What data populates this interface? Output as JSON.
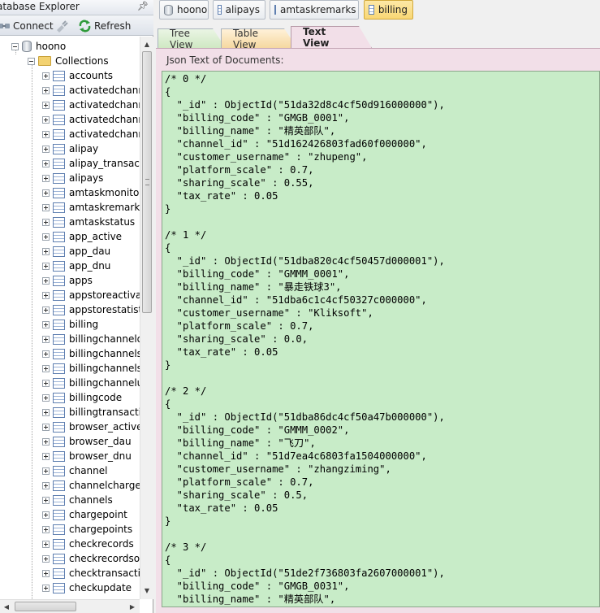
{
  "explorer": {
    "title": "atabase Explorer",
    "toolbar": {
      "connect": "Connect",
      "refresh": "Refresh"
    },
    "server": "hoono",
    "collections_label": "Collections",
    "collections": [
      "accounts",
      "activatedchann",
      "activatedchann",
      "activatedchann",
      "activatedchann",
      "alipay",
      "alipay_transacti",
      "alipays",
      "amtaskmonitor",
      "amtaskremarks",
      "amtaskstatus",
      "app_active",
      "app_dau",
      "app_dnu",
      "apps",
      "appstoreactivat",
      "appstorestatisti",
      "billing",
      "billingchanneld",
      "billingchannels",
      "billingchannels",
      "billingchannelu",
      "billingcode",
      "billingtransactio",
      "browser_active",
      "browser_dau",
      "browser_dnu",
      "channel",
      "channelchargep",
      "channels",
      "chargepoint",
      "chargepoints",
      "checkrecords",
      "checkrecordsor",
      "checktransactio",
      "checkupdate"
    ]
  },
  "doc_tabs": [
    {
      "label": "hoono",
      "icon": "database-icon"
    },
    {
      "label": "alipays",
      "icon": "table-icon"
    },
    {
      "label": "amtaskremarks",
      "icon": "table-icon"
    },
    {
      "label": "billing",
      "icon": "table-icon",
      "active": true
    }
  ],
  "view_tabs": {
    "tree": "Tree View",
    "table": "Table View",
    "text": "Text View"
  },
  "content": {
    "label": "Json Text of Documents:",
    "json_text": "/* 0 */\n{\n  \"_id\" : ObjectId(\"51da32d8c4cf50d916000000\"),\n  \"billing_code\" : \"GMGB_0001\",\n  \"billing_name\" : \"精英部队\",\n  \"channel_id\" : \"51d162426803fad60f000000\",\n  \"customer_username\" : \"zhupeng\",\n  \"platform_scale\" : 0.7,\n  \"sharing_scale\" : 0.55,\n  \"tax_rate\" : 0.05\n}\n\n/* 1 */\n{\n  \"_id\" : ObjectId(\"51dba820c4cf50457d000001\"),\n  \"billing_code\" : \"GMMM_0001\",\n  \"billing_name\" : \"暴走铁球3\",\n  \"channel_id\" : \"51dba6c1c4cf50327c000000\",\n  \"customer_username\" : \"Kliksoft\",\n  \"platform_scale\" : 0.7,\n  \"sharing_scale\" : 0.0,\n  \"tax_rate\" : 0.05\n}\n\n/* 2 */\n{\n  \"_id\" : ObjectId(\"51dba86dc4cf50a47b000000\"),\n  \"billing_code\" : \"GMMM_0002\",\n  \"billing_name\" : \"飞刀\",\n  \"channel_id\" : \"51d7ea4c6803fa1504000000\",\n  \"customer_username\" : \"zhangziming\",\n  \"platform_scale\" : 0.7,\n  \"sharing_scale\" : 0.5,\n  \"tax_rate\" : 0.05\n}\n\n/* 3 */\n{\n  \"_id\" : ObjectId(\"51de2f736803fa2607000001\"),\n  \"billing_code\" : \"GMGB_0031\",\n  \"billing_name\" : \"精英部队\","
  }
}
